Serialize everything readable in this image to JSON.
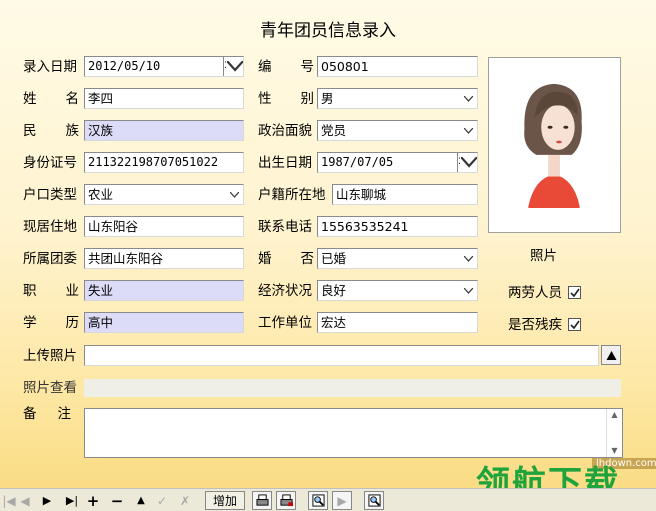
{
  "title": "青年团员信息录入",
  "labels": {
    "entry_date": [
      "录入日期"
    ],
    "id_no": [
      "编",
      "号"
    ],
    "name": [
      "姓",
      "名"
    ],
    "gender": [
      "性",
      "别"
    ],
    "ethnicity": [
      "民",
      "族"
    ],
    "political": [
      "政治面貌"
    ],
    "id_card": [
      "身份证号"
    ],
    "birthdate": [
      "出生日期"
    ],
    "hukou_type": [
      "户口类型"
    ],
    "hukou_place": [
      "户籍所在地"
    ],
    "address": [
      "现居住地"
    ],
    "phone": [
      "联系电话"
    ],
    "league_unit": [
      "所属团委"
    ],
    "marital": [
      "婚",
      "否"
    ],
    "occupation": [
      "职",
      "业"
    ],
    "economy": [
      "经济状况"
    ],
    "education": [
      "学",
      "历"
    ],
    "workplace": [
      "工作单位"
    ],
    "upload_photo": [
      "上传照片"
    ],
    "view_photo": [
      "照片查看"
    ],
    "remark": [
      "备",
      "注"
    ],
    "photo_caption": "照片",
    "labor_person": "两劳人员",
    "disabled": "是否残疾"
  },
  "values": {
    "entry_date": "2012/05/10",
    "id_no": "050801",
    "name": "李四",
    "gender": "男",
    "ethnicity": "汉族",
    "political": "党员",
    "id_card": "211322198707051022",
    "birthdate": "1987/07/05",
    "hukou_type": "农业",
    "hukou_place": "山东聊城",
    "address": "山东阳谷",
    "phone": "15563535241",
    "league_unit": "共团山东阳谷",
    "marital": "已婚",
    "occupation": "失业",
    "economy": "良好",
    "education": "高中",
    "workplace": "宏达",
    "upload_photo": "",
    "remark": ""
  },
  "checks": {
    "labor_person": true,
    "disabled": true
  },
  "toolbar": {
    "add_label": "增加",
    "icons": [
      "first-icon",
      "prev-icon",
      "next-icon",
      "last-icon",
      "plus-icon",
      "minus-icon",
      "up-icon",
      "check-icon",
      "cancel-icon",
      "print-icon",
      "print-preview-icon",
      "search-icon",
      "play-icon",
      "find-icon"
    ]
  },
  "watermark": {
    "site": "lhdown.com",
    "brand": "领航下载"
  },
  "colors": {
    "readonly_bg": "#dcdcf8",
    "bg_top": "#fffbe6",
    "bg_bottom": "#f9d97c",
    "brand_green": "#1fa33d"
  }
}
